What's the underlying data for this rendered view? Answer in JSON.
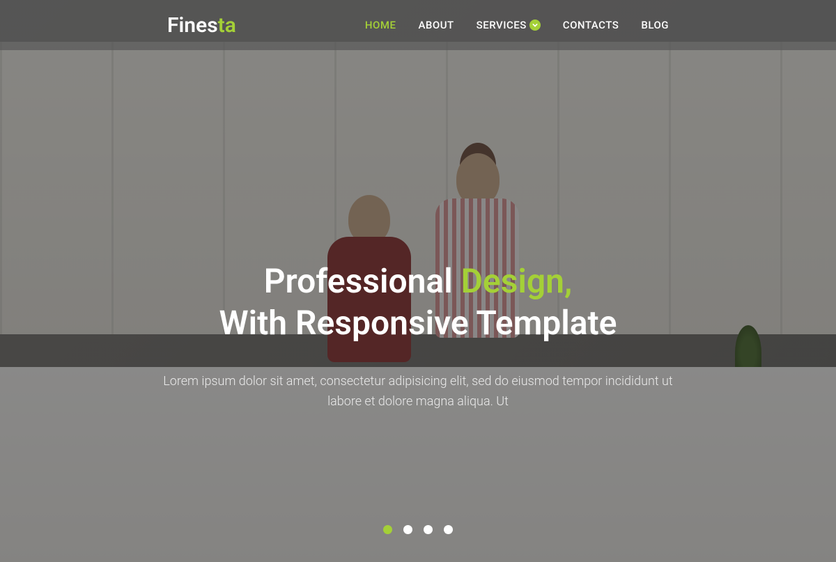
{
  "brand": {
    "part1": "Fines",
    "part2": "ta"
  },
  "nav": {
    "items": [
      {
        "label": "HOME",
        "active": true
      },
      {
        "label": "ABOUT",
        "active": false
      },
      {
        "label": "SERVICES",
        "active": false,
        "dropdown": true
      },
      {
        "label": "CONTACTS",
        "active": false
      },
      {
        "label": "BLOG",
        "active": false
      }
    ]
  },
  "hero": {
    "headline_part1": "Professional ",
    "headline_accent": "Design,",
    "headline_part2": "With Responsive Template",
    "subtext": "Lorem ipsum dolor sit amet, consectetur adipisicing elit, sed do eiusmod tempor incididunt ut labore et dolore magna aliqua. Ut"
  },
  "slider": {
    "dots": 4,
    "active": 0
  },
  "colors": {
    "accent": "#a4d037"
  }
}
